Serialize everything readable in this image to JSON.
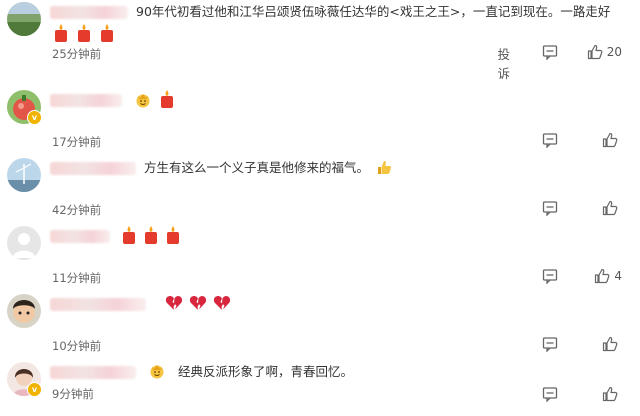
{
  "actions": {
    "report_label": "投诉",
    "reply_icon": "comment-icon",
    "like_icon": "thumbs-up-icon"
  },
  "comments": [
    {
      "text": "90年代初看过他和江华吕颂贤伍咏薇任达华的<戏王之王>，一直记到现在。一路走好",
      "time": "25分钟前",
      "likes": "20",
      "reaction_icons": [
        "candle-icon",
        "candle-icon",
        "candle-icon"
      ]
    },
    {
      "text": "",
      "time": "17分钟前",
      "likes": "",
      "reaction_icons": [
        "crown-face-icon",
        "candle-icon"
      ]
    },
    {
      "text": "方生有这么一个义子真是他修来的福气。",
      "time": "42分钟前",
      "likes": "",
      "reaction_icons": [
        "thumbs-up-emoji-icon"
      ]
    },
    {
      "text": "",
      "time": "11分钟前",
      "likes": "4",
      "reaction_icons": [
        "candle-icon",
        "candle-icon",
        "candle-icon"
      ]
    },
    {
      "text": "",
      "time": "10分钟前",
      "likes": "",
      "reaction_icons": [
        "broken-heart-icon",
        "broken-heart-icon",
        "broken-heart-icon"
      ]
    },
    {
      "text": "经典反派形象了啊，青春回忆。",
      "time": "9分钟前",
      "likes": "",
      "reaction_icons": [
        "crown-face-icon"
      ]
    }
  ]
}
